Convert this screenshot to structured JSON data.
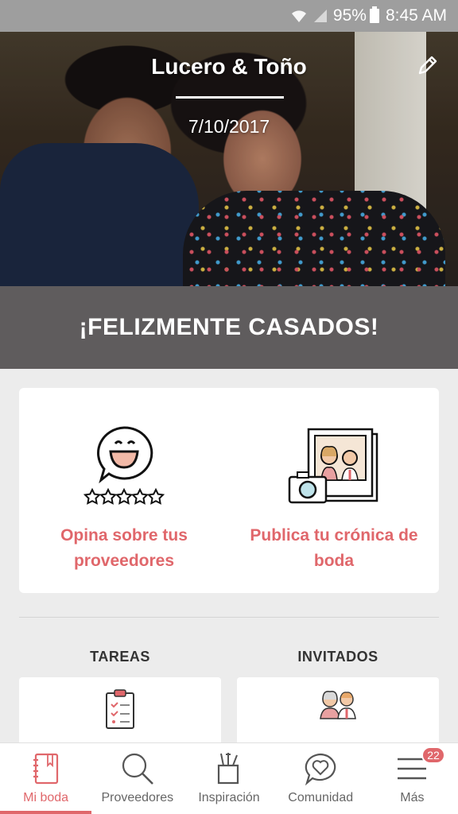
{
  "status_bar": {
    "battery": "95%",
    "time": "8:45 AM"
  },
  "hero": {
    "couple_name": "Lucero & Toño",
    "wedding_date": "7/10/2017"
  },
  "banner": {
    "text": "¡FELIZMENTE CASADOS!"
  },
  "actions": [
    {
      "label": "Opina sobre tus proveedores",
      "icon": "review-smile-icon"
    },
    {
      "label": "Publica tu crónica de boda",
      "icon": "photo-album-icon"
    }
  ],
  "sections": {
    "tasks_title": "TAREAS",
    "guests_title": "INVITADOS"
  },
  "bottom_nav": {
    "items": [
      {
        "label": "Mi boda",
        "icon": "notebook-icon",
        "active": true
      },
      {
        "label": "Proveedores",
        "icon": "search-icon"
      },
      {
        "label": "Inspiración",
        "icon": "inspiration-cup-icon"
      },
      {
        "label": "Comunidad",
        "icon": "heart-chat-icon"
      },
      {
        "label": "Más",
        "icon": "menu-icon",
        "badge": "22"
      }
    ]
  },
  "colors": {
    "accent": "#e0676b",
    "banner_bg": "#5f5c5d",
    "status_bar_bg": "#9e9e9e",
    "page_bg": "#ececec"
  }
}
